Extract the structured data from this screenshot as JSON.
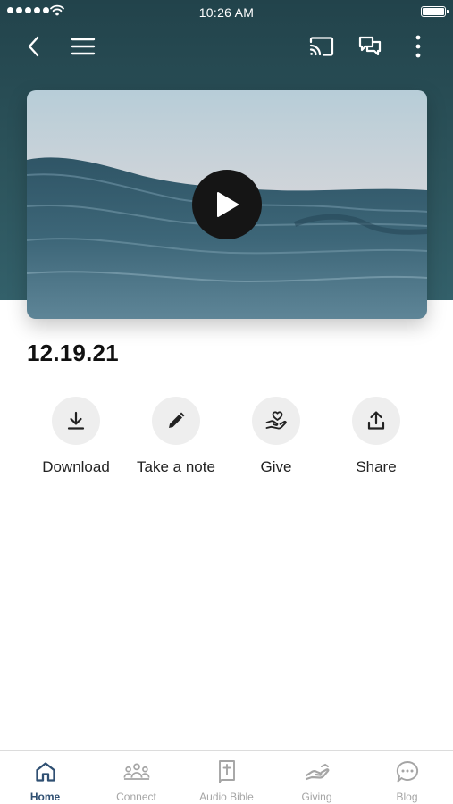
{
  "status_bar": {
    "time": "10:26 AM"
  },
  "nav": {
    "icons": [
      "back-icon",
      "menu-icon",
      "cast-icon",
      "chat-icon",
      "more-icon"
    ]
  },
  "video": {
    "icon": "play-icon"
  },
  "episode": {
    "title": "12.19.21"
  },
  "actions": [
    {
      "label": "Download",
      "icon": "download-icon"
    },
    {
      "label": "Take a note",
      "icon": "pencil-icon"
    },
    {
      "label": "Give",
      "icon": "heart-hand-icon"
    },
    {
      "label": "Share",
      "icon": "share-icon"
    }
  ],
  "tabs": [
    {
      "label": "Home",
      "icon": "home-icon",
      "active": true
    },
    {
      "label": "Connect",
      "icon": "people-icon",
      "active": false
    },
    {
      "label": "Audio Bible",
      "icon": "bible-icon",
      "active": false
    },
    {
      "label": "Giving",
      "icon": "giving-hand-icon",
      "active": false
    },
    {
      "label": "Blog",
      "icon": "chat-bubble-icon",
      "active": false
    }
  ],
  "colors": {
    "header": "#2c535b",
    "active_tab": "#2f4f72",
    "inactive_tab": "#a5a5a5",
    "action_circle": "#eeeeee"
  }
}
